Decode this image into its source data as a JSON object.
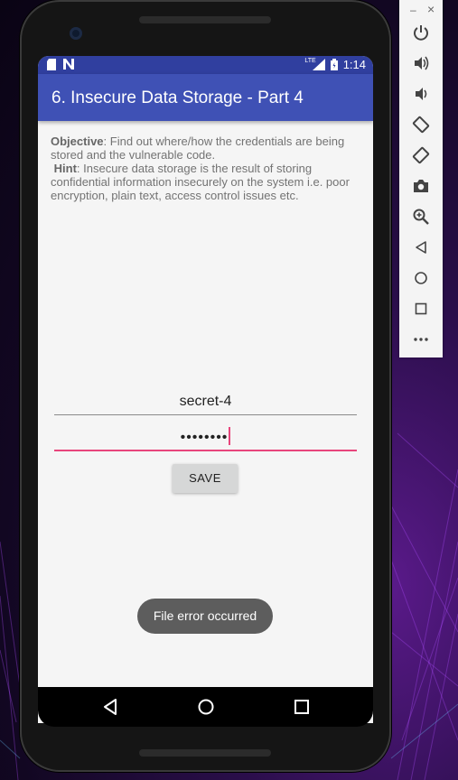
{
  "statusbar": {
    "left_icons": [
      "sd-card-icon",
      "notification-n-icon"
    ],
    "network": "LTE",
    "time": "1:14"
  },
  "app": {
    "title": "6. Insecure Data Storage - Part 4",
    "objective_label": "Objective",
    "objective_text": ": Find out where/how the credentials are being stored and the vulnerable code.",
    "hint_label": "Hint",
    "hint_text": ": Insecure data storage is the result of storing confidential information insecurely on the system i.e. poor encryption, plain text, access control issues etc.",
    "username_value": "secret-4",
    "password_value": "••••••••",
    "save_label": "SAVE",
    "toast": "File error occurred"
  },
  "navbar": {
    "items": [
      "back-icon",
      "home-icon",
      "recents-icon"
    ]
  },
  "emulator_toolbar": {
    "minimize": "–",
    "close": "×",
    "buttons": [
      "power-icon",
      "volume-up-icon",
      "volume-down-icon",
      "rotate-left-icon",
      "rotate-right-icon",
      "camera-icon",
      "zoom-icon",
      "back-icon",
      "home-icon",
      "overview-icon",
      "more-icon"
    ]
  },
  "colors": {
    "primary": "#3f51b5",
    "primary_dark": "#303f9f",
    "accent": "#e8457c"
  }
}
